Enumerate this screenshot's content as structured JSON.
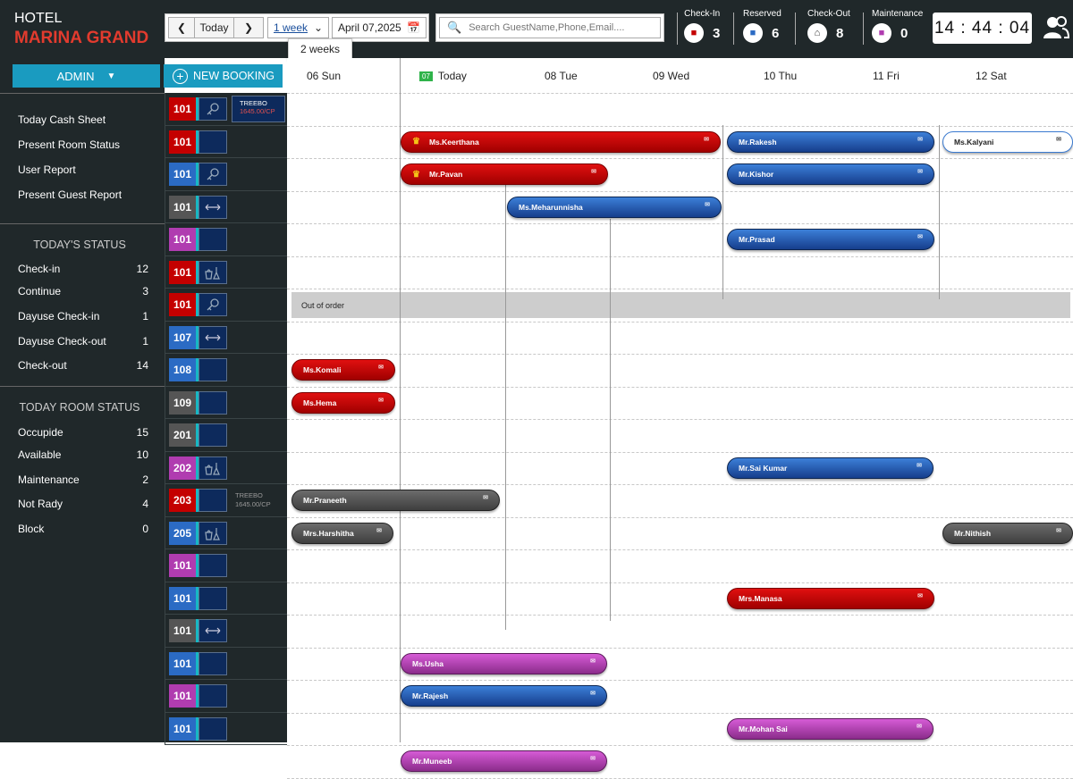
{
  "hotel": {
    "line1": "HOTEL",
    "line2": "MARINA GRAND"
  },
  "toolbar": {
    "today": "Today",
    "range": "1 week",
    "range_option": "2 weeks",
    "date": "April 07,2025"
  },
  "search": {
    "placeholder": "Search GuestName,Phone,Email...."
  },
  "stats": [
    {
      "label": "Check-In",
      "value": "3",
      "icon": "bed-icon"
    },
    {
      "label": "Reserved",
      "value": "6",
      "icon": "reserved-bed-icon"
    },
    {
      "label": "Check-Out",
      "value": "8",
      "icon": "checkout-icon"
    },
    {
      "label": "Maintenance",
      "value": "0",
      "icon": "maintenance-icon"
    }
  ],
  "clock": "14 : 44 : 04",
  "left": {
    "admin": "ADMIN",
    "new_booking": "NEW BOOKING",
    "menu": [
      "Today Cash Sheet",
      "Present Room Status",
      "User Report",
      "Present Guest Report"
    ],
    "todays_status_title": "TODAY'S STATUS",
    "todays_status": [
      {
        "label": "Check-in",
        "value": "12"
      },
      {
        "label": "Continue",
        "value": "3"
      },
      {
        "label": "Dayuse Check-in",
        "value": "1"
      },
      {
        "label": "Dayuse Check-out",
        "value": "1"
      },
      {
        "label": "Check-out",
        "value": "14"
      }
    ],
    "room_status_title": "TODAY ROOM STATUS",
    "room_status": [
      {
        "label": "Occupide",
        "value": "15"
      },
      {
        "label": "Available",
        "value": "10"
      },
      {
        "label": "Maintenance",
        "value": "2"
      },
      {
        "label": "Not Rady",
        "value": "4"
      },
      {
        "label": "Block",
        "value": "0"
      }
    ]
  },
  "rooms": [
    {
      "num": "101",
      "color": "#c40000",
      "icon": "key-icon",
      "rate1": "TREEBO",
      "rate2": "1645.00/CP"
    },
    {
      "num": "101",
      "color": "#c40000",
      "icon": "",
      "rate1": "",
      "rate2": ""
    },
    {
      "num": "101",
      "color": "#2b6bc4",
      "icon": "key-icon",
      "rate1": "",
      "rate2": ""
    },
    {
      "num": "101",
      "color": "#555555",
      "icon": "arrows-icon",
      "rate1": "",
      "rate2": ""
    },
    {
      "num": "101",
      "color": "#b03cb0",
      "icon": "",
      "rate1": "",
      "rate2": ""
    },
    {
      "num": "101",
      "color": "#c40000",
      "icon": "cleaning-icon",
      "rate1": "",
      "rate2": ""
    },
    {
      "num": "101",
      "color": "#c40000",
      "icon": "key-icon",
      "rate1": "",
      "rate2": ""
    },
    {
      "num": "107",
      "color": "#2b6bc4",
      "icon": "arrows-icon",
      "rate1": "",
      "rate2": ""
    },
    {
      "num": "108",
      "color": "#2b6bc4",
      "icon": "",
      "rate1": "",
      "rate2": ""
    },
    {
      "num": "109",
      "color": "#555555",
      "icon": "",
      "rate1": "",
      "rate2": ""
    },
    {
      "num": "201",
      "color": "#555555",
      "icon": "",
      "rate1": "",
      "rate2": ""
    },
    {
      "num": "202",
      "color": "#b03cb0",
      "icon": "cleaning-icon",
      "rate1": "",
      "rate2": ""
    },
    {
      "num": "203",
      "color": "#c40000",
      "icon": "",
      "rate1": "TREEBO",
      "rate2": "1645.00/CP"
    },
    {
      "num": "205",
      "color": "#2b6bc4",
      "icon": "cleaning-icon",
      "rate1": "",
      "rate2": ""
    },
    {
      "num": "101",
      "color": "#b03cb0",
      "icon": "",
      "rate1": "",
      "rate2": ""
    },
    {
      "num": "101",
      "color": "#2b6bc4",
      "icon": "",
      "rate1": "",
      "rate2": ""
    },
    {
      "num": "101",
      "color": "#555555",
      "icon": "arrows-icon",
      "rate1": "",
      "rate2": ""
    },
    {
      "num": "101",
      "color": "#2b6bc4",
      "icon": "",
      "rate1": "",
      "rate2": ""
    },
    {
      "num": "101",
      "color": "#b03cb0",
      "icon": "",
      "rate1": "",
      "rate2": ""
    },
    {
      "num": "101",
      "color": "#2b6bc4",
      "icon": "",
      "rate1": "",
      "rate2": ""
    }
  ],
  "days": [
    {
      "label": "06 Sun",
      "today": false
    },
    {
      "label": "Today",
      "badge": "07",
      "today": true
    },
    {
      "label": "08 Tue",
      "today": false
    },
    {
      "label": "09 Wed",
      "today": false
    },
    {
      "label": "10 Thu",
      "today": false
    },
    {
      "label": "11 Fri",
      "today": false
    },
    {
      "label": "12 Sat",
      "today": false
    }
  ],
  "bookings": [
    {
      "name": "Ms.Keerthana",
      "style": "red",
      "crown": true
    },
    {
      "name": "Mr.Rakesh",
      "style": "blue"
    },
    {
      "name": "Ms.Kalyani",
      "style": "white"
    },
    {
      "name": "Mr.Pavan",
      "style": "red",
      "crown": true
    },
    {
      "name": "Mr.Kishor",
      "style": "blue"
    },
    {
      "name": "Ms.Meharunnisha",
      "style": "blue"
    },
    {
      "name": "Mr.Prasad",
      "style": "blue"
    },
    {
      "name": "Ms.Komali",
      "style": "red"
    },
    {
      "name": "Ms.Hema",
      "style": "red"
    },
    {
      "name": "Mr.Sai Kumar",
      "style": "blue"
    },
    {
      "name": "Mr.Praneeth",
      "style": "gray"
    },
    {
      "name": "Mrs.Harshitha",
      "style": "gray"
    },
    {
      "name": "Mr.Nithish",
      "style": "gray"
    },
    {
      "name": "Mrs.Manasa",
      "style": "red"
    },
    {
      "name": "Ms.Usha",
      "style": "pink"
    },
    {
      "name": "Mr.Rajesh",
      "style": "blue"
    },
    {
      "name": "Mr.Mohan Sai",
      "style": "pink"
    },
    {
      "name": "Mr.Muneeb",
      "style": "pink"
    }
  ],
  "out_of_order": "Out of order"
}
